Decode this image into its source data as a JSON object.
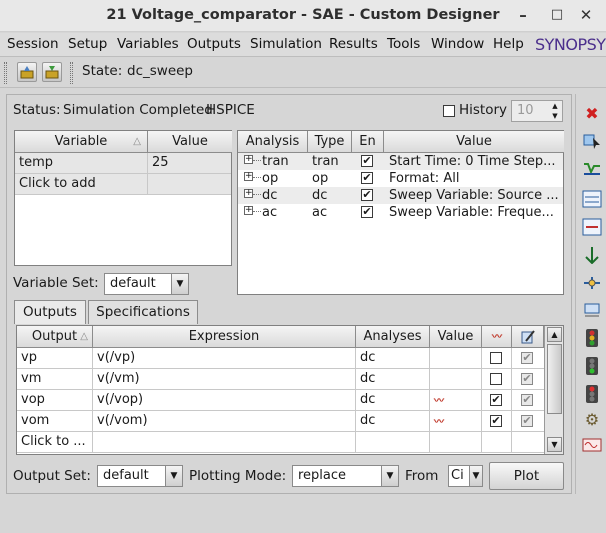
{
  "window": {
    "title": "21 Voltage_comparator - SAE - Custom Designer",
    "min_glyph": "✖",
    "minimize": "–",
    "maximize": "□",
    "close": "✕"
  },
  "menu": {
    "items": [
      "Session",
      "Setup",
      "Variables",
      "Outputs",
      "Simulation",
      "Results",
      "Tools",
      "Window",
      "Help"
    ],
    "brand": "SYNOPSYS"
  },
  "toolbar": {
    "state_label": "State:",
    "state_value": "dc_sweep"
  },
  "status": {
    "label": "Status:",
    "text": "Simulation Completed",
    "simulator": "HSPICE",
    "history_label": "History",
    "history_value": "10"
  },
  "variables": {
    "headers": [
      "Variable",
      "Value"
    ],
    "rows": [
      {
        "name": "temp",
        "value": "25"
      },
      {
        "name": "Click to add",
        "value": ""
      }
    ],
    "set_label": "Variable Set:",
    "set_value": "default"
  },
  "analyses": {
    "headers": [
      "Analysis",
      "Type",
      "En",
      "Value"
    ],
    "rows": [
      {
        "name": "tran",
        "type": "tran",
        "enabled": true,
        "value": "Start Time: 0 Time Step..."
      },
      {
        "name": "op",
        "type": "op",
        "enabled": true,
        "value": "Format: All"
      },
      {
        "name": "dc",
        "type": "dc",
        "enabled": true,
        "value": "Sweep Variable: Source ..."
      },
      {
        "name": "ac",
        "type": "ac",
        "enabled": true,
        "value": "Sweep Variable: Freque..."
      }
    ]
  },
  "tabs": [
    "Outputs",
    "Specifications"
  ],
  "outputs": {
    "headers": [
      "Output",
      "Expression",
      "Analyses",
      "Value"
    ],
    "rows": [
      {
        "name": "vp",
        "expr": "v(/vp)",
        "analyses": "dc",
        "wave": false,
        "plot": false,
        "save": true
      },
      {
        "name": "vm",
        "expr": "v(/vm)",
        "analyses": "dc",
        "wave": false,
        "plot": false,
        "save": true
      },
      {
        "name": "vop",
        "expr": "v(/vop)",
        "analyses": "dc",
        "wave": true,
        "plot": true,
        "save": true
      },
      {
        "name": "vom",
        "expr": "v(/vom)",
        "analyses": "dc",
        "wave": true,
        "plot": true,
        "save": true
      },
      {
        "name": "Click to ...",
        "expr": "",
        "analyses": "",
        "wave": false,
        "plot": null,
        "save": null
      }
    ]
  },
  "bottom": {
    "output_set_label": "Output Set:",
    "output_set_value": "default",
    "plotting_mode_label": "Plotting Mode:",
    "plotting_mode_value": "replace",
    "from_label": "From",
    "from_value": "Ci",
    "plot_button": "Plot"
  },
  "right_icons": [
    "close-icon",
    "select-icon",
    "run-icon",
    "tran-ac-icon",
    "param-icon",
    "netlist-icon",
    "model-icon",
    "stop-icon",
    "traffic-light-icon",
    "traffic-light-red-icon",
    "settings-icon",
    "waveform-icon"
  ]
}
